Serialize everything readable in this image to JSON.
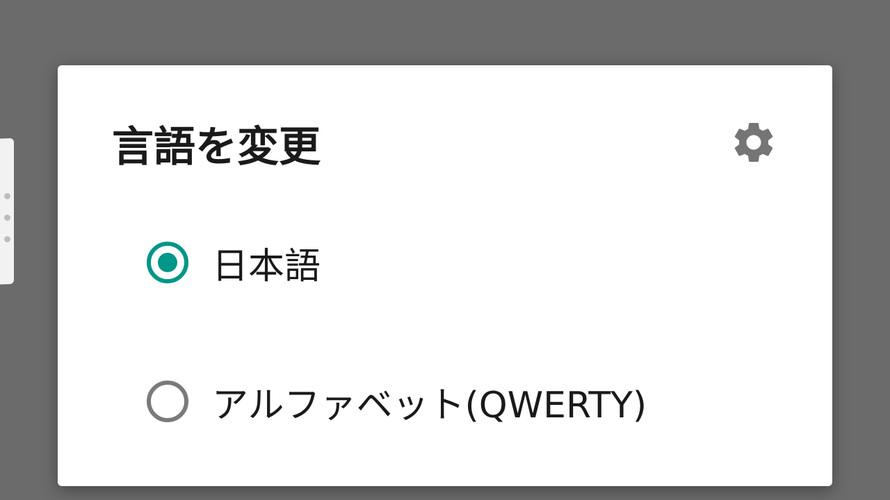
{
  "dialog": {
    "title": "言語を変更",
    "settings_icon": "gear-icon",
    "options": [
      {
        "label": "日本語",
        "selected": true
      },
      {
        "label": "アルファベット(QWERTY)",
        "selected": false
      }
    ]
  },
  "colors": {
    "accent": "#009688",
    "unselected_radio": "#7a7a7a",
    "overlay": "#6b6b6b",
    "settings_icon": "#757575"
  }
}
